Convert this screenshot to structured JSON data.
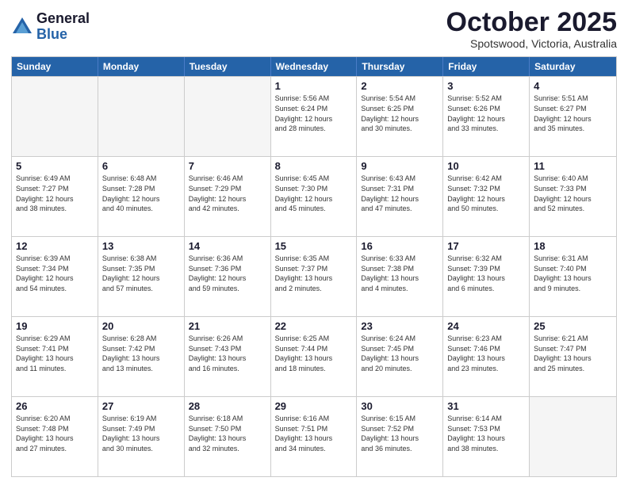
{
  "logo": {
    "general": "General",
    "blue": "Blue"
  },
  "title": "October 2025",
  "location": "Spotswood, Victoria, Australia",
  "days": [
    "Sunday",
    "Monday",
    "Tuesday",
    "Wednesday",
    "Thursday",
    "Friday",
    "Saturday"
  ],
  "weeks": [
    [
      {
        "day": "",
        "info": ""
      },
      {
        "day": "",
        "info": ""
      },
      {
        "day": "",
        "info": ""
      },
      {
        "day": "1",
        "info": "Sunrise: 5:56 AM\nSunset: 6:24 PM\nDaylight: 12 hours\nand 28 minutes."
      },
      {
        "day": "2",
        "info": "Sunrise: 5:54 AM\nSunset: 6:25 PM\nDaylight: 12 hours\nand 30 minutes."
      },
      {
        "day": "3",
        "info": "Sunrise: 5:52 AM\nSunset: 6:26 PM\nDaylight: 12 hours\nand 33 minutes."
      },
      {
        "day": "4",
        "info": "Sunrise: 5:51 AM\nSunset: 6:27 PM\nDaylight: 12 hours\nand 35 minutes."
      }
    ],
    [
      {
        "day": "5",
        "info": "Sunrise: 6:49 AM\nSunset: 7:27 PM\nDaylight: 12 hours\nand 38 minutes."
      },
      {
        "day": "6",
        "info": "Sunrise: 6:48 AM\nSunset: 7:28 PM\nDaylight: 12 hours\nand 40 minutes."
      },
      {
        "day": "7",
        "info": "Sunrise: 6:46 AM\nSunset: 7:29 PM\nDaylight: 12 hours\nand 42 minutes."
      },
      {
        "day": "8",
        "info": "Sunrise: 6:45 AM\nSunset: 7:30 PM\nDaylight: 12 hours\nand 45 minutes."
      },
      {
        "day": "9",
        "info": "Sunrise: 6:43 AM\nSunset: 7:31 PM\nDaylight: 12 hours\nand 47 minutes."
      },
      {
        "day": "10",
        "info": "Sunrise: 6:42 AM\nSunset: 7:32 PM\nDaylight: 12 hours\nand 50 minutes."
      },
      {
        "day": "11",
        "info": "Sunrise: 6:40 AM\nSunset: 7:33 PM\nDaylight: 12 hours\nand 52 minutes."
      }
    ],
    [
      {
        "day": "12",
        "info": "Sunrise: 6:39 AM\nSunset: 7:34 PM\nDaylight: 12 hours\nand 54 minutes."
      },
      {
        "day": "13",
        "info": "Sunrise: 6:38 AM\nSunset: 7:35 PM\nDaylight: 12 hours\nand 57 minutes."
      },
      {
        "day": "14",
        "info": "Sunrise: 6:36 AM\nSunset: 7:36 PM\nDaylight: 12 hours\nand 59 minutes."
      },
      {
        "day": "15",
        "info": "Sunrise: 6:35 AM\nSunset: 7:37 PM\nDaylight: 13 hours\nand 2 minutes."
      },
      {
        "day": "16",
        "info": "Sunrise: 6:33 AM\nSunset: 7:38 PM\nDaylight: 13 hours\nand 4 minutes."
      },
      {
        "day": "17",
        "info": "Sunrise: 6:32 AM\nSunset: 7:39 PM\nDaylight: 13 hours\nand 6 minutes."
      },
      {
        "day": "18",
        "info": "Sunrise: 6:31 AM\nSunset: 7:40 PM\nDaylight: 13 hours\nand 9 minutes."
      }
    ],
    [
      {
        "day": "19",
        "info": "Sunrise: 6:29 AM\nSunset: 7:41 PM\nDaylight: 13 hours\nand 11 minutes."
      },
      {
        "day": "20",
        "info": "Sunrise: 6:28 AM\nSunset: 7:42 PM\nDaylight: 13 hours\nand 13 minutes."
      },
      {
        "day": "21",
        "info": "Sunrise: 6:26 AM\nSunset: 7:43 PM\nDaylight: 13 hours\nand 16 minutes."
      },
      {
        "day": "22",
        "info": "Sunrise: 6:25 AM\nSunset: 7:44 PM\nDaylight: 13 hours\nand 18 minutes."
      },
      {
        "day": "23",
        "info": "Sunrise: 6:24 AM\nSunset: 7:45 PM\nDaylight: 13 hours\nand 20 minutes."
      },
      {
        "day": "24",
        "info": "Sunrise: 6:23 AM\nSunset: 7:46 PM\nDaylight: 13 hours\nand 23 minutes."
      },
      {
        "day": "25",
        "info": "Sunrise: 6:21 AM\nSunset: 7:47 PM\nDaylight: 13 hours\nand 25 minutes."
      }
    ],
    [
      {
        "day": "26",
        "info": "Sunrise: 6:20 AM\nSunset: 7:48 PM\nDaylight: 13 hours\nand 27 minutes."
      },
      {
        "day": "27",
        "info": "Sunrise: 6:19 AM\nSunset: 7:49 PM\nDaylight: 13 hours\nand 30 minutes."
      },
      {
        "day": "28",
        "info": "Sunrise: 6:18 AM\nSunset: 7:50 PM\nDaylight: 13 hours\nand 32 minutes."
      },
      {
        "day": "29",
        "info": "Sunrise: 6:16 AM\nSunset: 7:51 PM\nDaylight: 13 hours\nand 34 minutes."
      },
      {
        "day": "30",
        "info": "Sunrise: 6:15 AM\nSunset: 7:52 PM\nDaylight: 13 hours\nand 36 minutes."
      },
      {
        "day": "31",
        "info": "Sunrise: 6:14 AM\nSunset: 7:53 PM\nDaylight: 13 hours\nand 38 minutes."
      },
      {
        "day": "",
        "info": ""
      }
    ]
  ]
}
